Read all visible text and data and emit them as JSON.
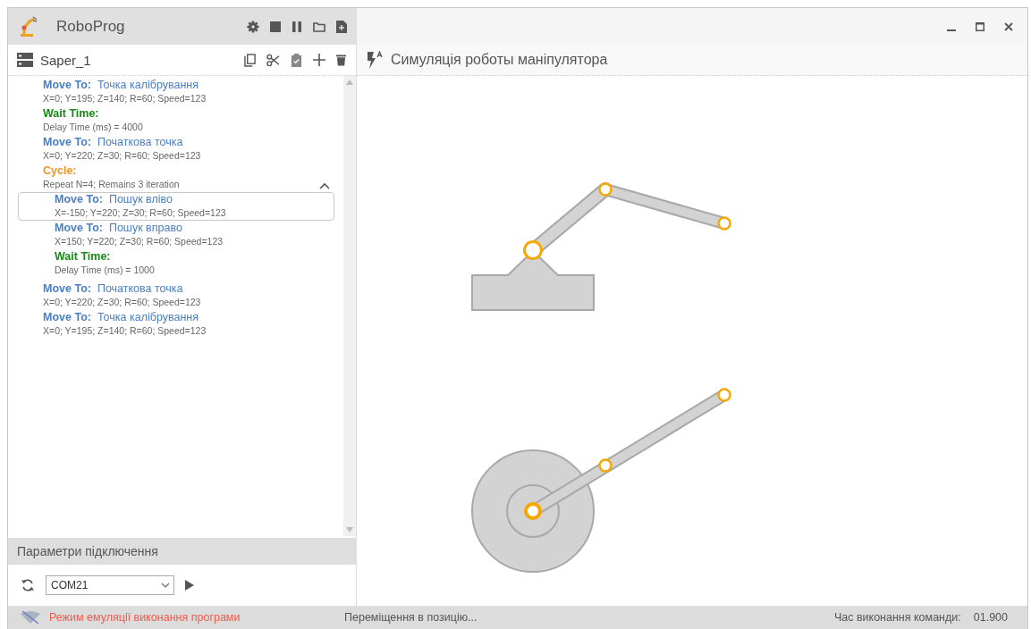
{
  "app": {
    "title": "RoboProg"
  },
  "program": {
    "name": "Saper_1",
    "items": [
      {
        "kind": "move",
        "label": "Move To:",
        "target": "Точка калібрування",
        "params": "X=0; Y=195; Z=140; R=60; Speed=123",
        "selected": false
      },
      {
        "kind": "wait",
        "label": "Wait Time:",
        "params": "Delay Time (ms) = 4000",
        "selected": false
      },
      {
        "kind": "move",
        "label": "Move To:",
        "target": "Початкова точка",
        "params": "X=0; Y=220; Z=30; R=60; Speed=123",
        "selected": false
      },
      {
        "kind": "cycle",
        "label": "Cycle:",
        "params": "Repeat N=4; Remains 3 iteration",
        "selected": false,
        "expanded": true,
        "children": [
          {
            "kind": "move",
            "label": "Move To:",
            "target": "Пошук вліво",
            "params": "X=-150; Y=220; Z=30; R=60; Speed=123",
            "selected": true
          },
          {
            "kind": "move",
            "label": "Move To:",
            "target": "Пошук вправо",
            "params": "X=150; Y=220; Z=30; R=60; Speed=123",
            "selected": false
          },
          {
            "kind": "wait",
            "label": "Wait Time:",
            "params": "Delay Time (ms) = 1000",
            "selected": false
          }
        ]
      },
      {
        "kind": "move",
        "label": "Move To:",
        "target": "Початкова точка",
        "params": "X=0; Y=220; Z=30; R=60; Speed=123",
        "selected": false
      },
      {
        "kind": "move",
        "label": "Move To:",
        "target": "Точка калібрування",
        "params": "X=0; Y=195; Z=140; R=60; Speed=123",
        "selected": false
      }
    ]
  },
  "connection": {
    "title": "Параметри підключення",
    "port": "COM21"
  },
  "simulation": {
    "title": "Симуляція роботы маніпулятора"
  },
  "status_bar": {
    "mode": "Режим емуляції виконання програми",
    "message": "Переміщення в позицію...",
    "time_label": "Час виконання команди:",
    "time_value": "01.900"
  }
}
